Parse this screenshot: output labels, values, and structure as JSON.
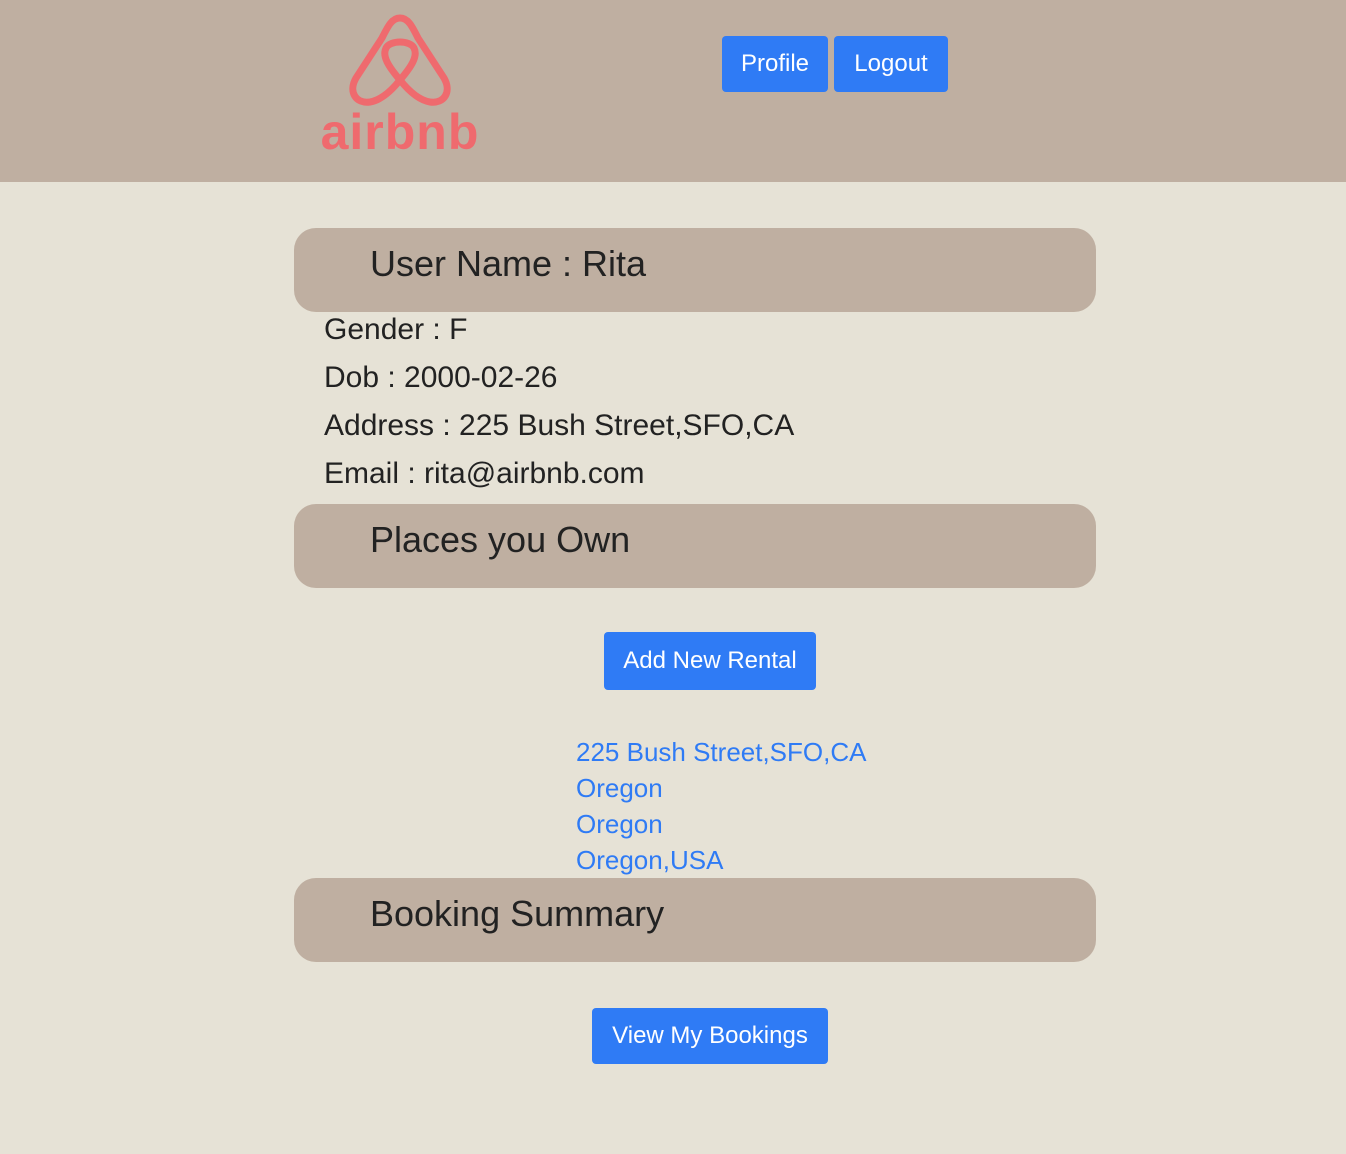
{
  "colors": {
    "header_bg": "#bfafa1",
    "page_bg": "#e6e2d6",
    "button_bg": "#2f7bf5",
    "link": "#2f7bf5",
    "logo": "#ef6a6e"
  },
  "header": {
    "logo_text": "airbnb",
    "logo_icon": "airbnb-belo-icon",
    "nav": {
      "profile_label": "Profile",
      "logout_label": "Logout"
    }
  },
  "user": {
    "name_line": "User Name : Rita",
    "gender_line": "Gender : F",
    "dob_line": "Dob : 2000-02-26",
    "address_line": "Address : 225 Bush Street,SFO,CA",
    "email_line": "Email : rita@airbnb.com"
  },
  "places": {
    "title": "Places you Own",
    "add_button_label": "Add New Rental",
    "rentals": [
      "225 Bush Street,SFO,CA",
      "Oregon",
      "Oregon",
      "Oregon,USA"
    ]
  },
  "bookings": {
    "title": "Booking Summary",
    "view_button_label": "View My Bookings"
  }
}
